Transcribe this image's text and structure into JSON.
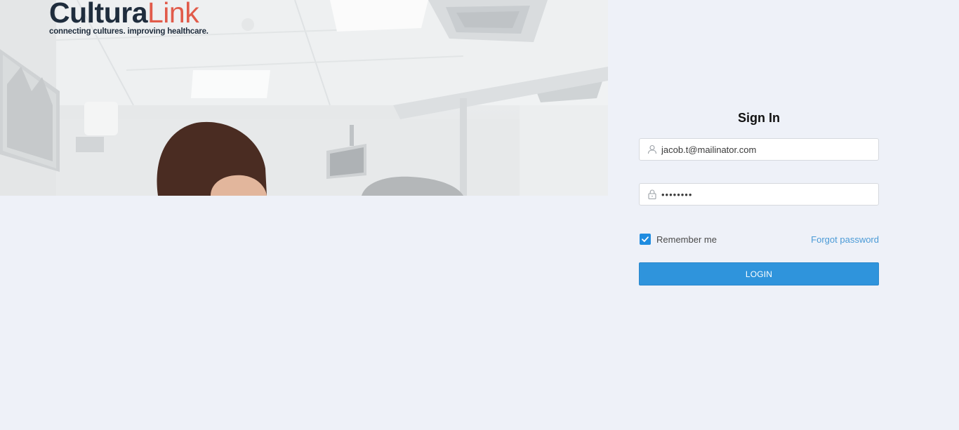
{
  "brand": {
    "name_part1": "Cultura",
    "name_part2": "Link",
    "tagline": "connecting cultures. improving healthcare.",
    "color_dark": "#1f2d3d",
    "color_accent": "#e15b4a"
  },
  "signin": {
    "title": "Sign In",
    "email": {
      "value": "jacob.t@mailinator.com",
      "icon": "user-icon"
    },
    "password": {
      "value": "••••••••",
      "icon": "lock-icon"
    },
    "remember_me": {
      "label": "Remember me",
      "checked": true
    },
    "forgot_password": "Forgot password",
    "login_button": "LOGIN"
  },
  "colors": {
    "background": "#eef1f8",
    "primary": "#2f94dc",
    "link": "#4a9ad6"
  }
}
